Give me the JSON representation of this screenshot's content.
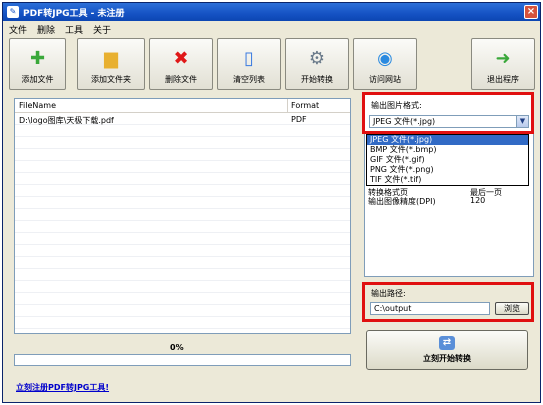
{
  "window": {
    "title": "PDF转JPG工具 - 未注册"
  },
  "menu": [
    "文件",
    "删除",
    "工具",
    "关于"
  ],
  "toolbar": [
    {
      "label": "添加文件",
      "icon": "add-file-icon",
      "color": "#3aa83a",
      "glyph": "✚"
    },
    {
      "label": "添加文件夹",
      "icon": "folder-icon",
      "color": "#e8b030",
      "glyph": "▆"
    },
    {
      "label": "删除文件",
      "icon": "delete-icon",
      "color": "#e01818",
      "glyph": "✖"
    },
    {
      "label": "清空列表",
      "icon": "trash-icon",
      "color": "#3a7ae0",
      "glyph": "▯"
    },
    {
      "label": "开始转换",
      "icon": "gears-icon",
      "color": "#6a7a8a",
      "glyph": "⚙"
    },
    {
      "label": "访问网站",
      "icon": "globe-icon",
      "color": "#2a8ae0",
      "glyph": "◉"
    },
    {
      "label": "退出程序",
      "icon": "exit-arrow-icon",
      "color": "#3aa83a",
      "glyph": "➜"
    }
  ],
  "file_list": {
    "columns": [
      "FileName",
      "Format"
    ],
    "rows": [
      {
        "name": "D:\\logo图库\\天极下载.pdf",
        "format": "PDF"
      }
    ]
  },
  "progress": {
    "label": "0%",
    "value": 0
  },
  "output_format": {
    "label": "输出图片格式:",
    "selected": "JPEG 文件(*.jpg)",
    "options": [
      "JPEG 文件(*.jpg)",
      "BMP 文件(*.bmp)",
      "GIF 文件(*.gif)",
      "PNG 文件(*.png)",
      "TIF 文件(*.tif)"
    ]
  },
  "properties": [
    {
      "key": "转换格式页",
      "value": "最后一页"
    },
    {
      "key": "输出图像精度(DPI)",
      "value": "120"
    }
  ],
  "output_path": {
    "label": "输出路径:",
    "value": "C:\\output",
    "browse": "浏览"
  },
  "start_button": {
    "label": "立刻开始转换"
  },
  "register_link": "立刻注册PDF转JPG工具!"
}
